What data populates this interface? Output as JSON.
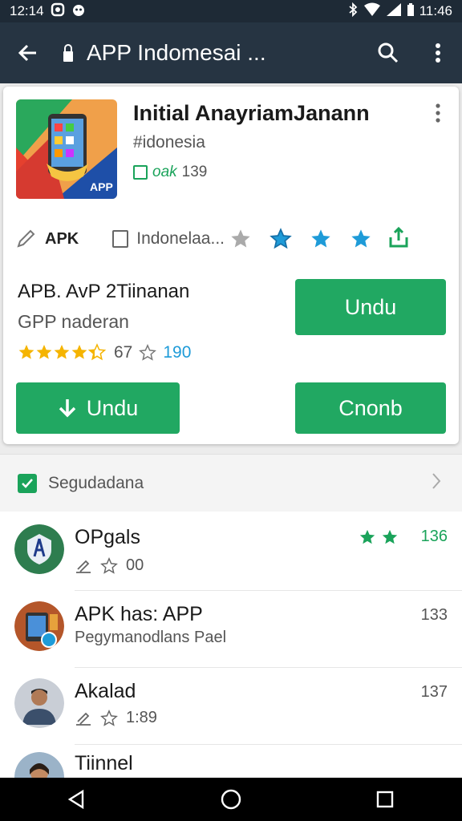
{
  "status_bar": {
    "time_left": "12:14",
    "time_right": "11:46"
  },
  "app_bar": {
    "title": "APP Indomesai ..."
  },
  "app": {
    "name": "Initial AnayriamJanann",
    "tag": "#idonesia",
    "meta_label": "oak",
    "meta_count": "139",
    "apk_label": "APK",
    "region_label": "Indonelaa...",
    "version": "APB. AvP 2Tiinanan",
    "subtitle": "GPP naderan",
    "rating_value": "67",
    "rating_count": "190",
    "stars_shown": 4.5
  },
  "buttons": {
    "install_top": "Undu",
    "download": "Undu",
    "open": "Cnonb"
  },
  "section": {
    "label": "Segudadana"
  },
  "list": [
    {
      "title": "OPgals",
      "sub": "00",
      "right": "136",
      "avatar": "shield-app-icon"
    },
    {
      "title": "APK has: APP",
      "sub": "Pegymanodlans Pael",
      "right": "133",
      "avatar": "tablet-app-icon"
    },
    {
      "title": "Akalad",
      "sub": "1:89",
      "right": "137",
      "avatar": "person-avatar"
    },
    {
      "title": "Tiinnel",
      "sub": "",
      "right": "",
      "avatar": "person-avatar"
    }
  ],
  "colors": {
    "green": "#21a862",
    "blue_star": "#1e9bd8",
    "gold_star": "#f5b400",
    "appbar": "#263442"
  }
}
